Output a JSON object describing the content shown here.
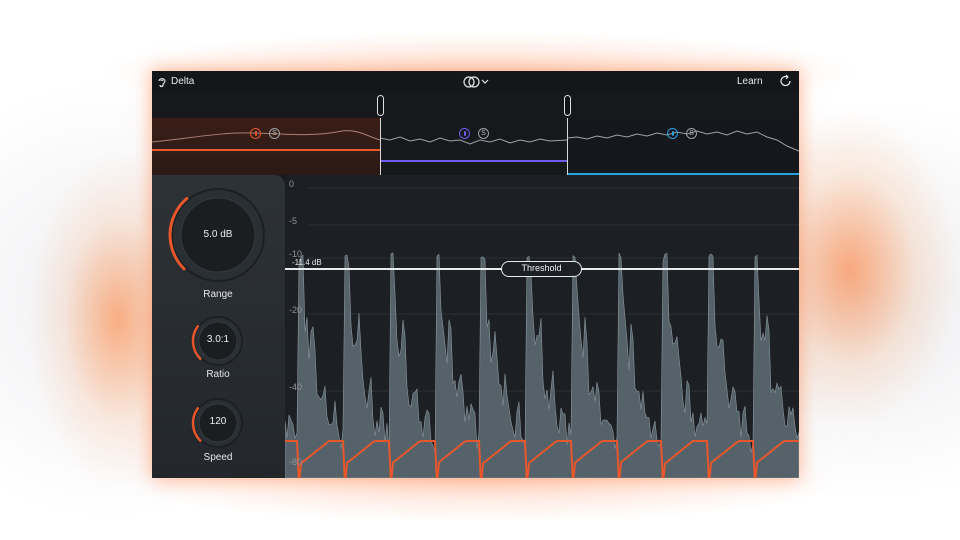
{
  "header": {
    "title": "Delta",
    "learn_label": "Learn"
  },
  "bands": [
    {
      "color": "#e8572b",
      "solo_label": "S"
    },
    {
      "color": "#6f5cf0",
      "solo_label": "S"
    },
    {
      "color": "#2a9fe0",
      "solo_label": "S"
    }
  ],
  "controls": {
    "range": {
      "label": "Range",
      "value": "5.0 dB",
      "level": 0.35
    },
    "ratio": {
      "label": "Ratio",
      "value": "3.0:1",
      "level": 0.3
    },
    "speed": {
      "label": "Speed",
      "value": "120",
      "level": 0.3
    }
  },
  "graph": {
    "y_ticks": [
      "0",
      "-5",
      "-10",
      "-20",
      "-40",
      "-80"
    ],
    "threshold_value": "-11.4 dB",
    "threshold_label": "Threshold"
  },
  "colors": {
    "accent": "#e8572b",
    "band_mid": "#6f5cf0",
    "band_high": "#2a9fe0",
    "waveform": "#5a666e",
    "gain_curve": "#e8572b"
  },
  "icons": {
    "listen": "ear-icon",
    "stereo": "stereo-link-icon",
    "dropdown": "chevron-down-icon",
    "learn": "refresh-icon"
  }
}
